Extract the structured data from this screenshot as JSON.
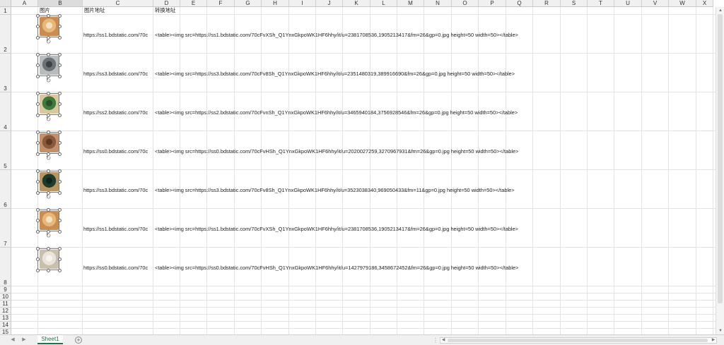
{
  "columns": [
    "A",
    "B",
    "C",
    "D",
    "E",
    "F",
    "G",
    "H",
    "I",
    "J",
    "K",
    "L",
    "M",
    "N",
    "O",
    "P",
    "Q",
    "R",
    "S",
    "T",
    "U",
    "V",
    "W",
    "X"
  ],
  "rows": [
    "1",
    "2",
    "3",
    "4",
    "5",
    "6",
    "7",
    "8",
    "9",
    "10",
    "11",
    "12",
    "13",
    "14",
    "15"
  ],
  "header_cells": {
    "b1": "图片",
    "c1": "图片地址",
    "d1": "转换地址"
  },
  "data_rows": [
    {
      "url": "https://ss1.bdstatic.com/70c",
      "html": "<table><img src=https://ss1.bdstatic.com/70cFvXSh_Q1YnxGkpoWK1HF6hhy/it/u=2381708536,1905213417&fm=26&gp=0.jpg height=50 width=50></table>",
      "thumb_colors": [
        "#e8b77a",
        "#c98c52",
        "#f4e2c4"
      ]
    },
    {
      "url": "https://ss3.bdstatic.com/70c",
      "html": "<table><img src=https://ss3.bdstatic.com/70cFv8Sh_Q1YnxGkpoWK1HF6hhy/it/u=2351480319,389916690&fm=26&gp=0.jpg height=50 width=50></table>",
      "thumb_colors": [
        "#6c7275",
        "#b8bcbd",
        "#3d4245"
      ]
    },
    {
      "url": "https://ss2.bdstatic.com/70c",
      "html": "<table><img src=https://ss2.bdstatic.com/70cFvnSh_Q1YnxGkpoWK1HF6hhy/it/u=3465940184,3756928546&fm=26&gp=0.jpg height=50 width=50></table>",
      "thumb_colors": [
        "#3e7b3a",
        "#d9c7a0",
        "#2b4f2a"
      ]
    },
    {
      "url": "https://ss0.bdstatic.com/70c",
      "html": "<table><img src=https://ss0.bdstatic.com/70cFvHSh_Q1YnxGkpoWK1HF6hhy/it/u=2020027259,3270967931&fm=26&gp=0.jpg height=50 width=50></table>",
      "thumb_colors": [
        "#8a5a3c",
        "#c2906a",
        "#5a3a26"
      ]
    },
    {
      "url": "https://ss3.bdstatic.com/70c",
      "html": "<table><img src=https://ss3.bdstatic.com/70cFv8Sh_Q1YnxGkpoWK1HF6hhy/it/u=3523038340,969050433&fm=11&gp=0.jpg height=50 width=50></table>",
      "thumb_colors": [
        "#1f3b2c",
        "#b99563",
        "#10241a"
      ]
    },
    {
      "url": "https://ss1.bdstatic.com/70c",
      "html": "<table><img src=https://ss1.bdstatic.com/70cFvXSh_Q1YnxGkpoWK1HF6hhy/it/u=2381708536,1905213417&fm=26&gp=0.jpg height=50 width=50></table>",
      "thumb_colors": [
        "#e8b77a",
        "#c98c52",
        "#f4e2c4"
      ]
    },
    {
      "url": "https://ss0.bdstatic.com/70c",
      "html": "<table><img src=https://ss0.bdstatic.com/70cFvHSh_Q1YnxGkpoWK1HF6hhy/it/u=1427979186,3458672452&fm=26&gp=0.jpg height=50 width=50></table>",
      "thumb_colors": [
        "#e9e4da",
        "#c9bfae",
        "#f7f4ee"
      ]
    }
  ],
  "sheet_tab": "Sheet1",
  "accent_color": "#217346"
}
